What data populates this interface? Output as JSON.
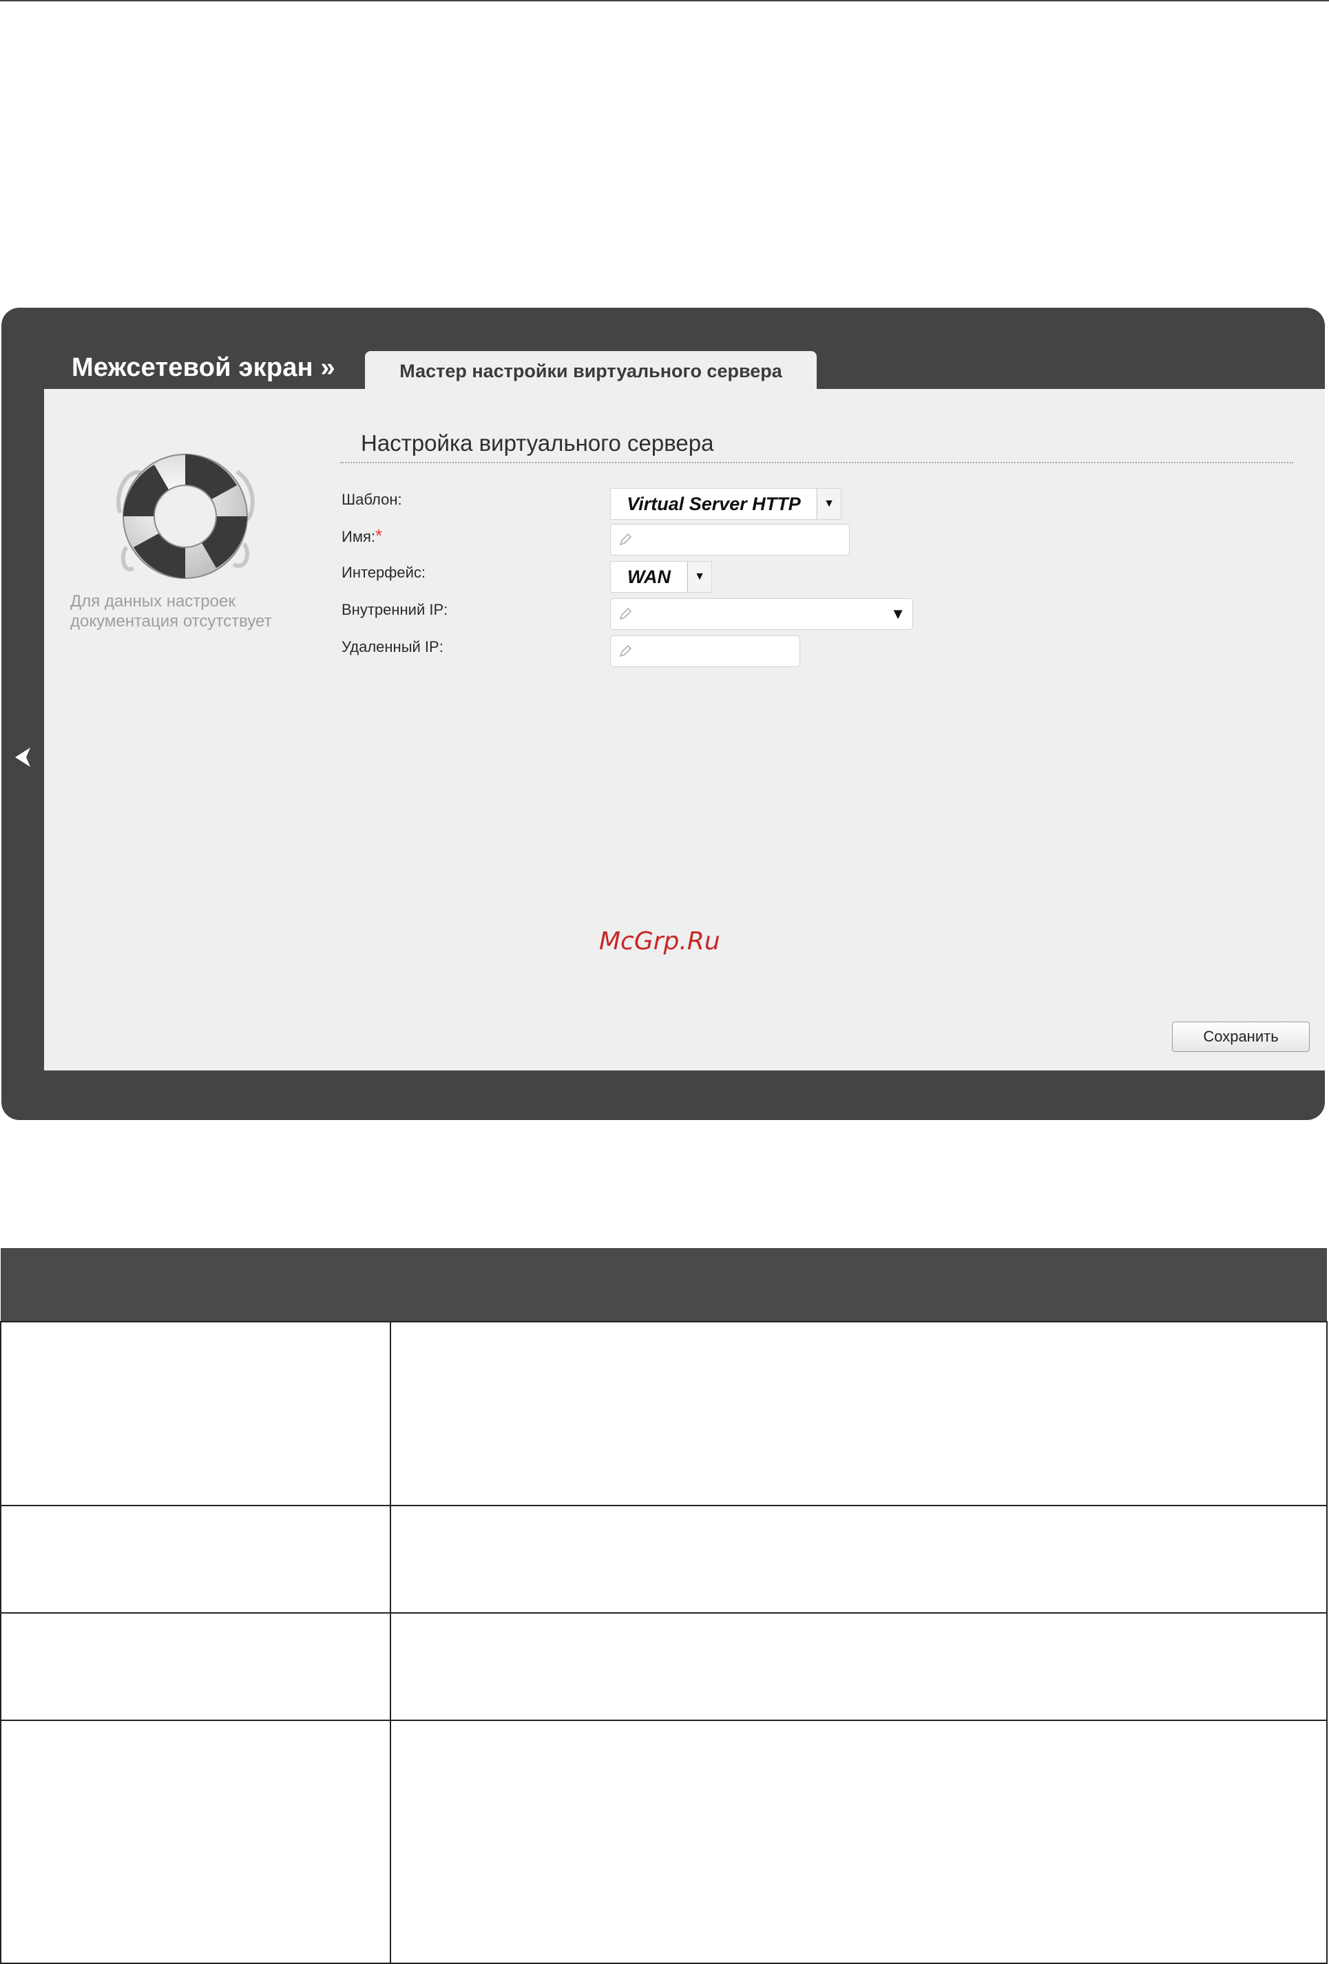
{
  "screen": {
    "title": "Межсетевой экран »",
    "tab_label": "Мастер настройки виртуального сервера",
    "help_text": "Для данных настроек документация отсутствует",
    "section_title": "Настройка виртуального сервера",
    "fields": {
      "template": {
        "label": "Шаблон:",
        "value": "Virtual Server HTTP"
      },
      "name": {
        "label": "Имя:",
        "required_mark": "*",
        "value": ""
      },
      "interface": {
        "label": "Интерфейс:",
        "value": "WAN"
      },
      "internal_ip": {
        "label": "Внутренний IP:",
        "value": ""
      },
      "remote_ip": {
        "label": "Удаленный IP:",
        "value": ""
      }
    },
    "save_label": "Сохранить",
    "watermark": "McGrp.Ru"
  },
  "doc_table": {
    "header": [
      "",
      ""
    ],
    "rows": [
      [
        "",
        ""
      ],
      [
        "",
        ""
      ],
      [
        "",
        ""
      ],
      [
        "",
        ""
      ]
    ]
  },
  "colors": {
    "frame": "#444446",
    "panel": "#efefef",
    "table_header": "#4a4a4a",
    "required": "#e53935",
    "watermark": "#c62828"
  },
  "icons": [
    "lifebuoy-icon",
    "pencil-icon",
    "chevron-left-icon",
    "dropdown-arrow-icon"
  ]
}
